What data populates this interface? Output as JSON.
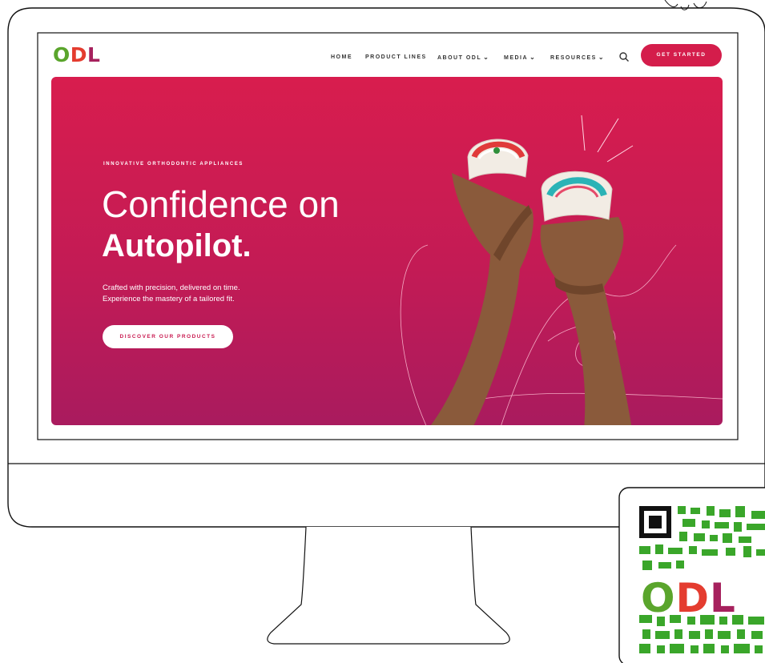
{
  "logo": {
    "o": "O",
    "d": "D",
    "l": "L"
  },
  "nav": {
    "items": [
      {
        "label": "HOME",
        "dropdown": false
      },
      {
        "label": "PRODUCT LINES",
        "dropdown": false
      },
      {
        "label": "ABOUT ODL",
        "dropdown": true
      },
      {
        "label": "MEDIA",
        "dropdown": true
      },
      {
        "label": "RESOURCES",
        "dropdown": true
      }
    ],
    "cta_label": "GET STARTED"
  },
  "hero": {
    "eyebrow": "INNOVATIVE ORTHODONTIC APPLIANCES",
    "headline_line1": "Confidence on",
    "headline_line2": "Autopilot.",
    "subtext_line1": "Crafted with precision, delivered on time.",
    "subtext_line2": "Experience the mastery of a tailored fit.",
    "button_label": "DISCOVER OUR PRODUCTS"
  },
  "qr": {
    "o": "O",
    "d": "D",
    "l": "L"
  },
  "colors": {
    "brand_red": "#d41d4b",
    "hero_top": "#d81d4e",
    "hero_bottom": "#a91b5e",
    "logo_green": "#5aa52c",
    "logo_red": "#e43c2f",
    "logo_purple": "#a6215d",
    "qr_green": "#3aa62a"
  }
}
